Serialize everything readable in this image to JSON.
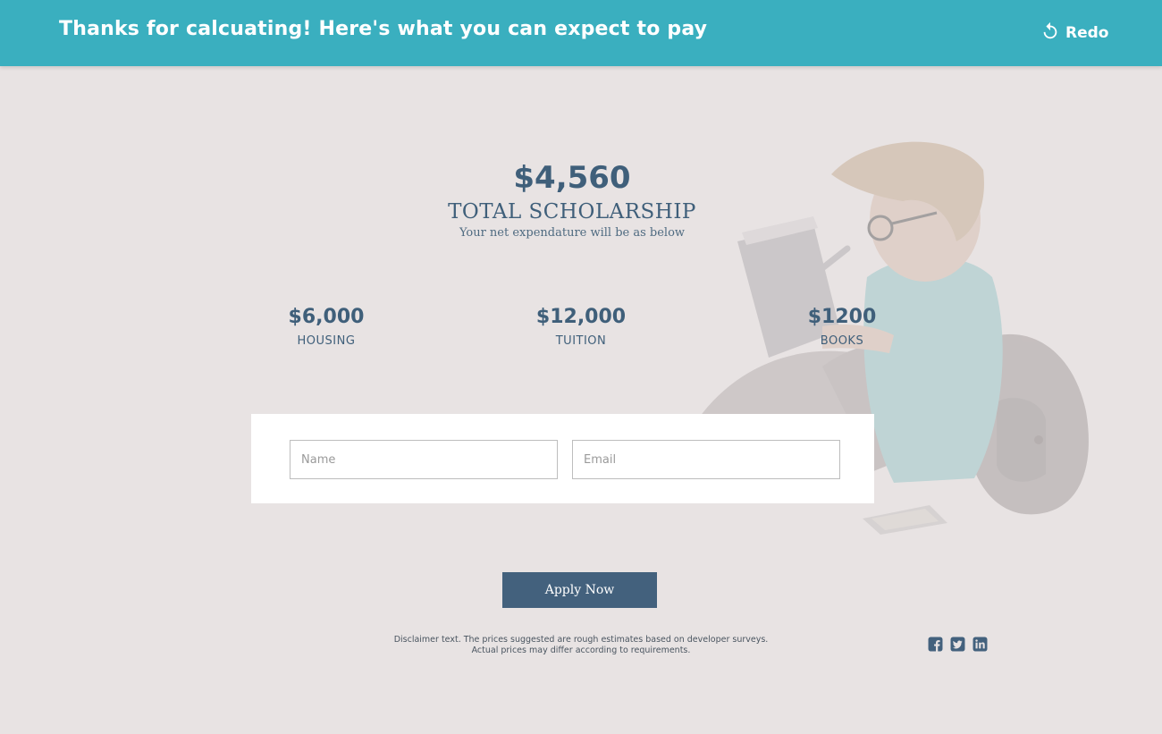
{
  "header": {
    "title": "Thanks for calcuating! Here's what you can expect to pay",
    "redo_label": "Redo",
    "redo_icon": "redo-icon"
  },
  "summary": {
    "amount": "$4,560",
    "label": "TOTAL SCHOLARSHIP",
    "subtitle": "Your net expendature will be as below"
  },
  "breakdown": [
    {
      "value": "$6,000",
      "label": "HOUSING"
    },
    {
      "value": "$12,000",
      "label": "TUITION"
    },
    {
      "value": "$1200",
      "label": "BOOKS"
    }
  ],
  "form": {
    "name_placeholder": "Name",
    "email_placeholder": "Email"
  },
  "apply_label": "Apply Now",
  "disclaimer": {
    "line1": "Disclaimer text. The prices suggested are rough estimates  based on developer surveys.",
    "line2": "Actual prices  may differ according to requirements."
  },
  "social": {
    "icons": [
      "facebook-icon",
      "twitter-icon",
      "linkedin-icon"
    ],
    "color": "#43617d"
  },
  "colors": {
    "header_bg": "#3aafbf",
    "background": "#e8e3e3",
    "text_primary": "#3f5f7a",
    "button_bg": "#43617d"
  }
}
